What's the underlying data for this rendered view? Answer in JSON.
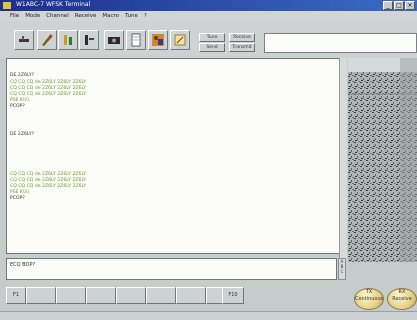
{
  "titlebar": {
    "title": "W1ABC-7 WFSK Terminal"
  },
  "menu": [
    {
      "label": "File"
    },
    {
      "label": "Mode"
    },
    {
      "label": "Channel"
    },
    {
      "label": "Receive"
    },
    {
      "label": "Macro"
    },
    {
      "label": "Tune"
    },
    {
      "label": "?"
    }
  ],
  "toolbar": {
    "small_buttons": [
      {
        "label": "Tune"
      },
      {
        "label": "Receive"
      },
      {
        "label": "Send"
      },
      {
        "label": "Transmit"
      }
    ]
  },
  "receive_text": {
    "lines": [
      {
        "text": "CQ CQ CQ de 2Z6LY 2Z6LY",
        "color": "#6b9a2a",
        "row": 0
      },
      {
        "text": "DE 2Z6LY?",
        "color": "#333333",
        "row": 0
      },
      {
        "text": "CQ CQ CQ de 2Z6LY 2Z6LY 2Z6LY",
        "color": "#6b9a2a",
        "row": 1
      },
      {
        "text": "CQ CQ CQ de 2Z6LY 2Z6LY 2Z6LY",
        "color": "#6b9a2a",
        "row": 2
      },
      {
        "text": "CQ CQ CQ de 2Z6LY 2Z6LY 2Z6LY",
        "color": "#6b9a2a",
        "row": 3
      },
      {
        "text": "PSE K\\\\\\\\",
        "color": "#6b9a2a",
        "row": 4
      },
      {
        "text": "PCOP?",
        "color": "#333333",
        "row": 5
      },
      {
        "text": "DE 2Z6LY?",
        "color": "#333333",
        "row": 6
      },
      {
        "text": "CQ CQ CQ de 2Z6LY 2Z6LY 2Z6LY",
        "color": "#6b9a2a",
        "row": 7
      },
      {
        "text": "CQ CQ CQ de 2Z6LY 2Z6LY 2Z6LY",
        "color": "#6b9a2a",
        "row": 8
      },
      {
        "text": "CQ CQ CQ de 2Z6LY 2Z6LY 2Z6LY",
        "color": "#6b9a2a",
        "row": 9
      },
      {
        "text": "PSE K\\\\\\\\",
        "color": "#6b9a2a",
        "row": 10
      },
      {
        "text": "PCOP?",
        "color": "#333333",
        "row": 11
      }
    ]
  },
  "transmit": {
    "text": "ECQ BOP?"
  },
  "scroll_labels": [
    "A",
    "B",
    "C"
  ],
  "function_keys": [
    {
      "label": "F1"
    },
    {
      "label": ""
    },
    {
      "label": ""
    },
    {
      "label": ""
    },
    {
      "label": ""
    },
    {
      "label": ""
    },
    {
      "label": ""
    },
    {
      "label": ""
    },
    {
      "label": ""
    },
    {
      "label": "F10"
    }
  ],
  "round_buttons": [
    {
      "label": "TX",
      "sub": "Continuous"
    },
    {
      "label": "RX",
      "sub": "Receive"
    }
  ]
}
